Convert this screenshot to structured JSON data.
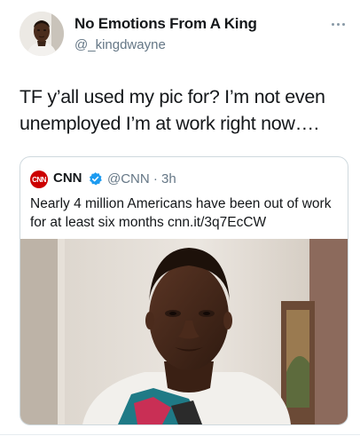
{
  "author": {
    "name": "No Emotions From A King",
    "handle": "@_kingdwayne",
    "avatar_icon": "person-photo"
  },
  "tweet": {
    "text": "TF y’all used my pic for? I’m not even unemployed I’m at work right now…."
  },
  "more_icon": "ellipsis-icon",
  "quote": {
    "logo_text": "CNN",
    "name": "CNN",
    "handle_time": "@CNN · 3h",
    "text": "Nearly 4 million Americans have been out of work for at least six months cnn.it/3q7EcCW",
    "photo_icon": "man-selfie-photo"
  },
  "colors": {
    "text": "#14171a",
    "secondary": "#657786",
    "border": "#cfd9de",
    "cnn_red": "#cc0000",
    "verified_blue": "#1d9bf0"
  }
}
